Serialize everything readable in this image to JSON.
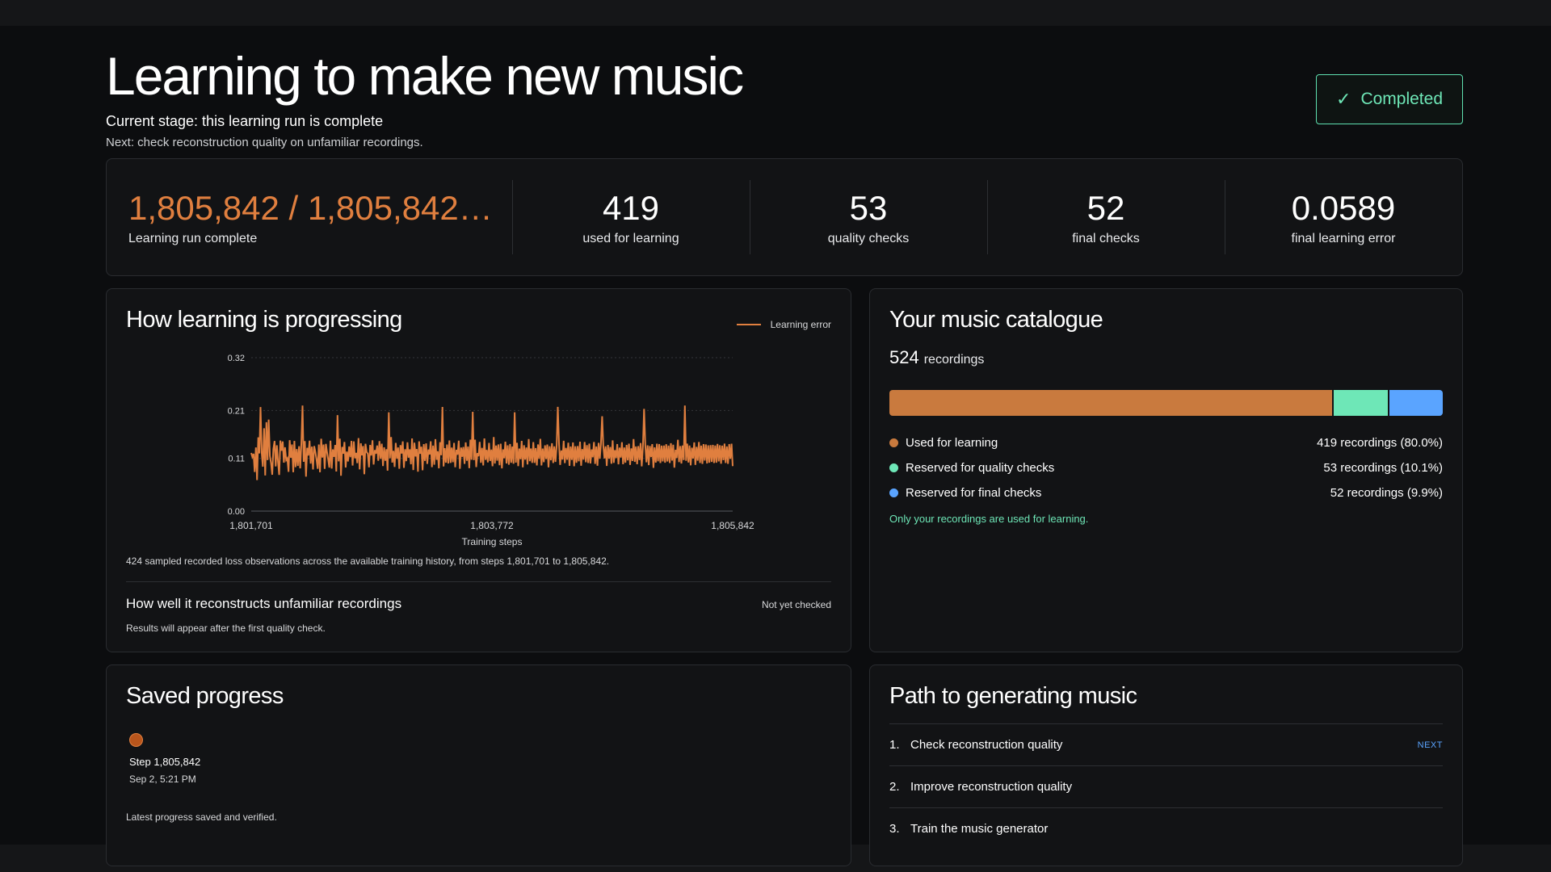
{
  "header": {
    "title": "Learning to make new music",
    "stage": "Current stage: this learning run is complete",
    "next": "Next: check reconstruction quality on unfamiliar recordings.",
    "status_check": "✓",
    "status_label": "Completed"
  },
  "stats": {
    "run_value": "1,805,842 / 1,805,842…",
    "run_label": "Learning run complete",
    "used_value": "419",
    "used_label": "used for learning",
    "quality_value": "53",
    "quality_label": "quality checks",
    "final_value": "52",
    "final_label": "final checks",
    "error_value": "0.0589",
    "error_label": "final learning error"
  },
  "progress": {
    "title": "How learning is progressing",
    "note": "424 sampled recorded loss observations across the available training history, from steps 1,801,701 to 1,805,842.",
    "recon_title": "How well it reconstructs unfamiliar recordings",
    "recon_status": "Not yet checked",
    "recon_sub": "Results will appear after the first quality check."
  },
  "chart_data": {
    "type": "line",
    "xlabel": "Training steps",
    "ylabel": "",
    "xlim": [
      1801701,
      1805842
    ],
    "ylim": [
      0,
      0.32
    ],
    "x_ticks": [
      "1,801,701",
      "1,803,772",
      "1,805,842"
    ],
    "y_ticks": [
      "0.32",
      "0.21",
      "0.11",
      "0.00"
    ],
    "grid": true,
    "legend": "top-right",
    "series": [
      {
        "name": "Learning error",
        "color": "#e07f3f",
        "values": [
          0.1212,
          0.113,
          0.1195,
          0.0815,
          0.1328,
          0.0646,
          0.1538,
          0.1202,
          0.2171,
          0.1209,
          0.0926,
          0.1728,
          0.0742,
          0.1855,
          0.1064,
          0.191,
          0.1152,
          0.1008,
          0.0758,
          0.1294,
          0.1462,
          0.0932,
          0.1373,
          0.1024,
          0.0754,
          0.1472,
          0.126,
          0.1452,
          0.1011,
          0.1331,
          0.1065,
          0.1102,
          0.0819,
          0.1478,
          0.1112,
          0.1389,
          0.0811,
          0.1463,
          0.0917,
          0.1294,
          0.0941,
          0.1353,
          0.0891,
          0.1424,
          0.2201,
          0.1028,
          0.1461,
          0.0719,
          0.1318,
          0.1158,
          0.1469,
          0.0991,
          0.1344,
          0.0869,
          0.1355,
          0.1232,
          0.1076,
          0.0882,
          0.1389,
          0.081,
          0.1509,
          0.1116,
          0.1388,
          0.0881,
          0.1402,
          0.1234,
          0.1085,
          0.0907,
          0.1468,
          0.0887,
          0.1286,
          0.1131,
          0.1379,
          0.0825,
          0.2002,
          0.1038,
          0.151,
          0.0738,
          0.1339,
          0.1198,
          0.1441,
          0.0909,
          0.1242,
          0.1035,
          0.1348,
          0.1125,
          0.1463,
          0.095,
          0.1454,
          0.1102,
          0.1215,
          0.1001,
          0.1522,
          0.0871,
          0.1415,
          0.1162,
          0.1357,
          0.077,
          0.1404,
          0.1229,
          0.1198,
          0.0913,
          0.1379,
          0.1159,
          0.1477,
          0.0971,
          0.1271,
          0.1198,
          0.1367,
          0.1049,
          0.1461,
          0.1089,
          0.1405,
          0.0939,
          0.133,
          0.105,
          0.129,
          0.0844,
          0.2059,
          0.1101,
          0.1545,
          0.1012,
          0.1256,
          0.0922,
          0.1422,
          0.1091,
          0.1328,
          0.0883,
          0.1376,
          0.1201,
          0.1454,
          0.0903,
          0.1292,
          0.1043,
          0.1435,
          0.1115,
          0.1288,
          0.0977,
          0.1515,
          0.0855,
          0.1427,
          0.1138,
          0.1294,
          0.0822,
          0.1456,
          0.1197,
          0.1342,
          0.0853,
          0.1396,
          0.1048,
          0.1411,
          0.0984,
          0.1285,
          0.118,
          0.1456,
          0.0916,
          0.1366,
          0.0966,
          0.1501,
          0.1069,
          0.1248,
          0.0892,
          0.1437,
          0.1165,
          0.2173,
          0.0931,
          0.1312,
          0.1011,
          0.1387,
          0.0993,
          0.1474,
          0.1005,
          0.1326,
          0.102,
          0.1422,
          0.0914,
          0.1279,
          0.1176,
          0.1469,
          0.0882,
          0.1326,
          0.1131,
          0.1338,
          0.0986,
          0.1434,
          0.1049,
          0.1348,
          0.0896,
          0.149,
          0.1071,
          0.2072,
          0.1063,
          0.1489,
          0.0918,
          0.1209,
          0.1143,
          0.1444,
          0.1008,
          0.1318,
          0.0954,
          0.1514,
          0.1068,
          0.1276,
          0.1016,
          0.1421,
          0.1045,
          0.1283,
          0.0936,
          0.1544,
          0.0992,
          0.1367,
          0.1051,
          0.1391,
          0.0957,
          0.1407,
          0.0891,
          0.1289,
          0.1101,
          0.1446,
          0.0993,
          0.1371,
          0.0967,
          0.14,
          0.1007,
          0.1345,
          0.0989,
          0.2061,
          0.101,
          0.1425,
          0.0938,
          0.1303,
          0.1082,
          0.1463,
          0.0913,
          0.1374,
          0.1072,
          0.1327,
          0.0973,
          0.1503,
          0.1041,
          0.1306,
          0.1005,
          0.144,
          0.1005,
          0.1315,
          0.0953,
          0.1392,
          0.1089,
          0.1508,
          0.0954,
          0.1304,
          0.1021,
          0.1371,
          0.1087,
          0.1387,
          0.0912,
          0.1353,
          0.106,
          0.1414,
          0.1003,
          0.135,
          0.1026,
          0.1364,
          0.2175,
          0.1412,
          0.0964,
          0.1265,
          0.1074,
          0.1467,
          0.1001,
          0.1318,
          0.1071,
          0.1426,
          0.0944,
          0.1347,
          0.1067,
          0.1432,
          0.0937,
          0.1352,
          0.1007,
          0.1358,
          0.1039,
          0.1446,
          0.0946,
          0.1293,
          0.1073,
          0.1441,
          0.1019,
          0.1376,
          0.1004,
          0.1408,
          0.0993,
          0.1285,
          0.1123,
          0.1441,
          0.0983,
          0.1347,
          0.0946,
          0.1423,
          0.1092,
          0.1406,
          0.1979,
          0.1368,
          0.1098,
          0.1351,
          0.0942,
          0.138,
          0.1093,
          0.1337,
          0.0989,
          0.1476,
          0.1006,
          0.1272,
          0.1106,
          0.1398,
          0.0975,
          0.1324,
          0.1117,
          0.1436,
          0.0978,
          0.1327,
          0.1009,
          0.1379,
          0.1057,
          0.1406,
          0.0963,
          0.1308,
          0.1046,
          0.1502,
          0.1027,
          0.1349,
          0.0978,
          0.1355,
          0.1064,
          0.142,
          0.0933,
          0.1351,
          0.2132,
          0.1383,
          0.1017,
          0.1371,
          0.0958,
          0.1357,
          0.1126,
          0.1396,
          0.0903,
          0.1329,
          0.1013,
          0.1405,
          0.1039,
          0.1398,
          0.1003,
          0.1364,
          0.1037,
          0.1368,
          0.1009,
          0.1394,
          0.1034,
          0.1365,
          0.1004,
          0.1417,
          0.1054,
          0.1384,
          0.0906,
          0.1278,
          0.1108,
          0.1488,
          0.1023,
          0.1355,
          0.0993,
          0.1368,
          0.1064,
          0.2201,
          0.1049,
          0.1407,
          0.1014,
          0.1368,
          0.0955,
          0.1322,
          0.1097,
          0.1433,
          0.0964,
          0.1339,
          0.1051,
          0.1441,
          0.1004,
          0.1366,
          0.0984,
          0.1397,
          0.1054,
          0.139,
          0.0994,
          0.1371,
          0.1011,
          0.1376,
          0.1027,
          0.1381,
          0.1003,
          0.1368,
          0.1009,
          0.1402,
          0.1038,
          0.1372,
          0.0989,
          0.1364,
          0.1063,
          0.1408,
          0.1003,
          0.1348,
          0.0985,
          0.1398,
          0.1089,
          0.1404,
          0.0938
        ]
      }
    ]
  },
  "catalogue": {
    "title": "Your music catalogue",
    "count": "524",
    "count_unit": "recordings",
    "segments": [
      {
        "label": "Used for learning",
        "value": "419 recordings (80.0%)",
        "fraction": 0.8,
        "color": "#c97a3e"
      },
      {
        "label": "Reserved for quality checks",
        "value": "53 recordings (10.1%)",
        "fraction": 0.101,
        "color": "#6ee7b7"
      },
      {
        "label": "Reserved for final checks",
        "value": "52 recordings (9.9%)",
        "fraction": 0.099,
        "color": "#5aa4ff"
      }
    ],
    "note": "Only your recordings are used for learning."
  },
  "saved": {
    "title": "Saved progress",
    "step": "Step 1,805,842",
    "time": "Sep 2, 5:21 PM",
    "note": "Latest progress saved and verified."
  },
  "path": {
    "title": "Path to generating music",
    "items": [
      {
        "num": "1.",
        "label": "Check reconstruction quality",
        "badge": "NEXT"
      },
      {
        "num": "2.",
        "label": "Improve reconstruction quality",
        "badge": ""
      },
      {
        "num": "3.",
        "label": "Train the music generator",
        "badge": ""
      }
    ]
  }
}
